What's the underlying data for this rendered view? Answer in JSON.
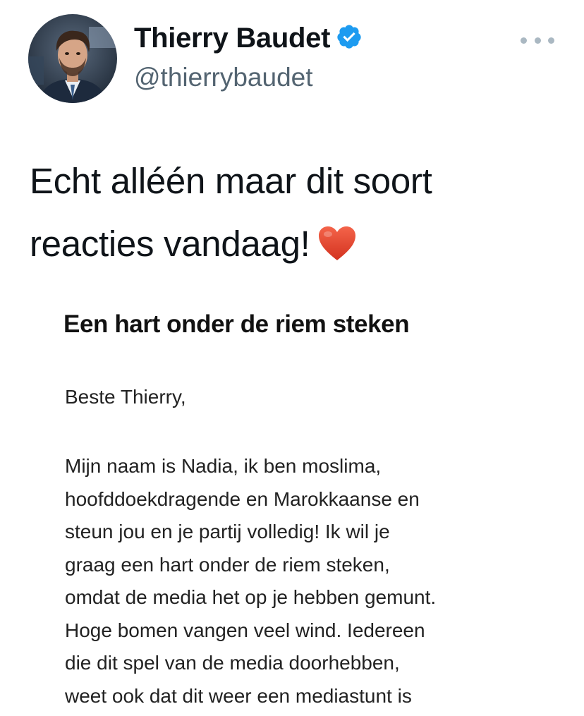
{
  "author": {
    "name": "Thierry Baudet",
    "handle": "@thierrybaudet",
    "verified": true,
    "avatar_icon": "profile-photo"
  },
  "menu": {
    "icon": "more-horizontal-icon"
  },
  "tweet": {
    "text_line_1": "Echt alléén maar dit soort",
    "text_line_2": "reacties vandaag!",
    "emoji": "red-heart-icon"
  },
  "attached_letter": {
    "title": "Een hart onder de riem steken",
    "greeting": "Beste Thierry,",
    "lines": [
      "Mijn naam is Nadia, ik ben moslima,",
      "hoofddoekdragende en Marokkaanse en",
      "steun jou en je partij volledig! Ik wil je",
      "graag een hart onder de riem steken,",
      "omdat de media het op je hebben gemunt.",
      "Hoge bomen vangen veel wind. Iedereen",
      "die dit spel van de media doorhebben,",
      "weet ook dat dit weer een mediastunt is"
    ]
  },
  "colors": {
    "text_primary": "#0f1419",
    "text_secondary": "#536471",
    "verified_blue": "#1d9bf0",
    "heart_red": "#e8432f",
    "menu_dots": "#aab8c2"
  }
}
